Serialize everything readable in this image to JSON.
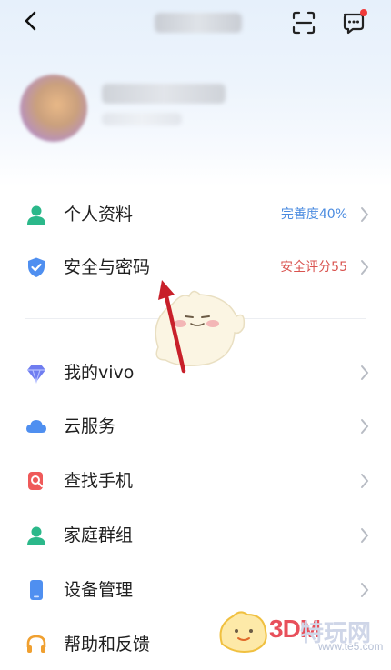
{
  "menu_primary": [
    {
      "label": "个人资料",
      "value": "完善度40%",
      "value_color": "#4a8be0",
      "icon": "person-icon"
    },
    {
      "label": "安全与密码",
      "value": "安全评分55",
      "value_color": "#d9534f",
      "icon": "shield-icon"
    }
  ],
  "menu_secondary": [
    {
      "label": "我的vivo",
      "icon": "diamond-icon"
    },
    {
      "label": "云服务",
      "icon": "cloud-icon"
    },
    {
      "label": "查找手机",
      "icon": "find-phone-icon"
    },
    {
      "label": "家庭群组",
      "icon": "family-group-icon"
    },
    {
      "label": "设备管理",
      "icon": "device-icon"
    },
    {
      "label": "帮助和反馈",
      "icon": "headset-icon"
    }
  ],
  "watermark": {
    "brand": "3DM",
    "site": "特玩网",
    "url": "www.te5.com"
  },
  "colors": {
    "accent": "#4a8be0",
    "warning": "#d9534f",
    "icon_blue": "#4f8ff0",
    "icon_green": "#2bb88a",
    "icon_red": "#ef5a5a"
  }
}
